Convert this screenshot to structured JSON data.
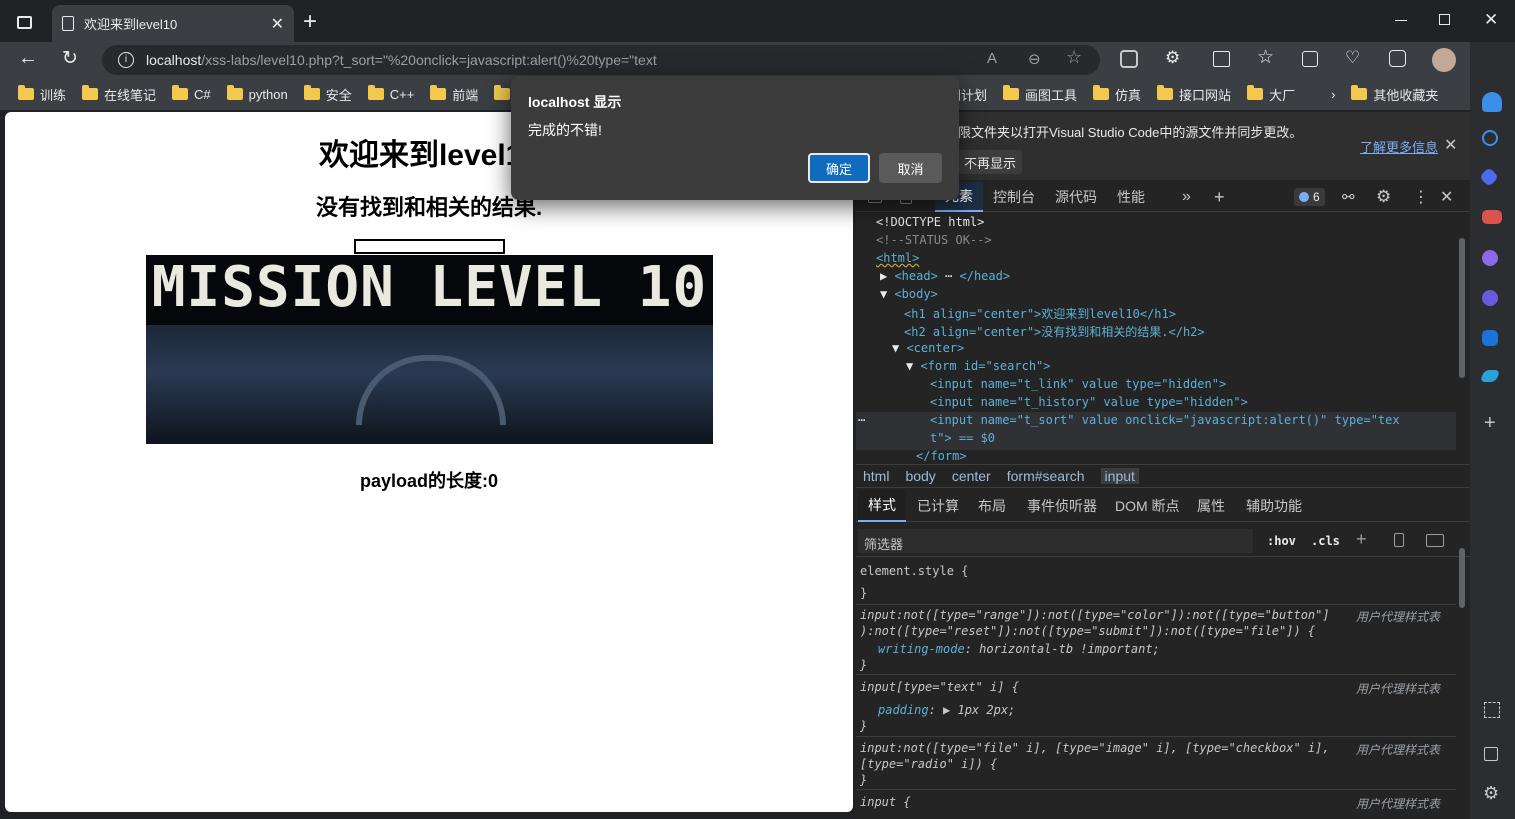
{
  "browser": {
    "tab_title": "欢迎来到level10",
    "new_tab": "+",
    "url_host": "localhost",
    "url_rest": "/xss-labs/level10.php?t_sort=\"%20onclick=javascript:alert()%20type=\"text",
    "bookmarks": [
      "训练",
      "在线笔记",
      "C#",
      "python",
      "安全",
      "C++",
      "前端",
      "",
      "间计划",
      "画图工具",
      "仿真",
      "接口网站",
      "大厂"
    ],
    "other_bookmarks": "其他收藏夹"
  },
  "page": {
    "h1": "欢迎来到level10",
    "h2": "没有找到和相关的结果.",
    "banner_text": "MISSION LEVEL 10",
    "payload": "payload的长度:0"
  },
  "dialog": {
    "title": "localhost 显示",
    "message": "完成的不错!",
    "ok": "确定",
    "cancel": "取消"
  },
  "devtools": {
    "infobar_text": "限文件夹以打开Visual Studio Code中的源文件并同步更改。",
    "learn_more": "了解更多信息",
    "dont_show": "不再显示",
    "tabs": [
      "元素",
      "控制台",
      "源代码",
      "性能"
    ],
    "issues_count": "6",
    "dom": [
      {
        "pre": "",
        "tag": "<!DOCTYPE html>"
      },
      {
        "cmt": "<!--STATUS OK-->"
      },
      {
        "tag": "<html>"
      },
      {
        "tag": "<head>",
        "rest": "</head>"
      },
      {
        "tag": "<body>"
      },
      {
        "tag": "<h1 align=\"center\">欢迎来到level10</h1>"
      },
      {
        "tag": "<h2 align=\"center\">没有找到和相关的结果.</h2>"
      },
      {
        "tag": "<center>"
      },
      {
        "tag": "<form id=\"search\">"
      },
      {
        "tag": "<input name=\"t_link\" value type=\"hidden\">"
      },
      {
        "tag": "<input name=\"t_history\" value type=\"hidden\">"
      },
      {
        "tag": "<input name=\"t_sort\" value onclick=\"javascript:alert()\" type=\"tex"
      },
      {
        "tag": "t\"> == $0"
      },
      {
        "tag": "</form>"
      }
    ],
    "breadcrumbs": [
      "html",
      "body",
      "center",
      "form#search",
      "input"
    ],
    "style_tabs": [
      "样式",
      "已计算",
      "布局",
      "事件侦听器",
      "DOM 断点",
      "属性",
      "辅助功能"
    ],
    "filter_placeholder": "筛选器",
    "hov": ":hov",
    "cls": ".cls",
    "rules": {
      "r1_sel": "element.style {",
      "r1_end": "}",
      "r2_sel_a": "input:not([type=\"range\"]):not([type=\"color\"]):not([type=\"button\"]",
      "r2_sel_b": "):not([type=\"reset\"]):not([type=\"submit\"]):not([type=\"file\"]) {",
      "r2_prop": "writing-mode",
      "r2_val": ": horizontal-tb !important;",
      "r3_sel": "input[type=\"text\" i] {",
      "r3_prop": "padding",
      "r3_val": ": ▶ 1px 2px;",
      "r4_sel_a": "input:not([type=\"file\" i], [type=\"image\" i], [type=\"checkbox\" i],",
      "r4_sel_b": "[type=\"radio\" i]) {",
      "r5_sel": "input {",
      "ua": "用户代理样式表",
      "close": "}"
    }
  }
}
